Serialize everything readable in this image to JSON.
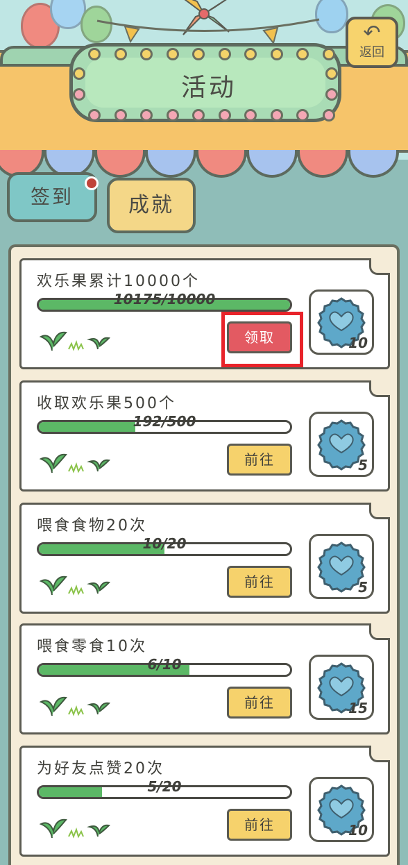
{
  "header": {
    "title": "活动",
    "back_label": "返回"
  },
  "tabs": [
    {
      "label": "签到",
      "has_notification": true
    },
    {
      "label": "成就",
      "selected": true
    }
  ],
  "tasks": [
    {
      "title": "欢乐果累计10000个",
      "progress_text": "10175/10000",
      "progress": 1.0,
      "action_label": "领取",
      "action_type": "claim",
      "reward_count": "10"
    },
    {
      "title": "收取欢乐果500个",
      "progress_text": "192/500",
      "progress": 0.384,
      "action_label": "前往",
      "action_type": "go",
      "reward_count": "5"
    },
    {
      "title": "喂食食物20次",
      "progress_text": "10/20",
      "progress": 0.5,
      "action_label": "前往",
      "action_type": "go",
      "reward_count": "5"
    },
    {
      "title": "喂食零食10次",
      "progress_text": "6/10",
      "progress": 0.6,
      "action_label": "前往",
      "action_type": "go",
      "reward_count": "15"
    },
    {
      "title": "为好友点赞20次",
      "progress_text": "5/20",
      "progress": 0.25,
      "action_label": "前往",
      "action_type": "go",
      "reward_count": "10"
    }
  ],
  "colors": {
    "progress_fill": "#5cb866",
    "claim_button": "#e35a62",
    "go_button": "#f6d26c",
    "reward_icon": "#5ea8c9",
    "highlight_box": "#e8232a"
  },
  "icons": {
    "reward": "bottle-cap-icon",
    "decoration": "sprout-icon",
    "back": "back-arrow-icon"
  }
}
